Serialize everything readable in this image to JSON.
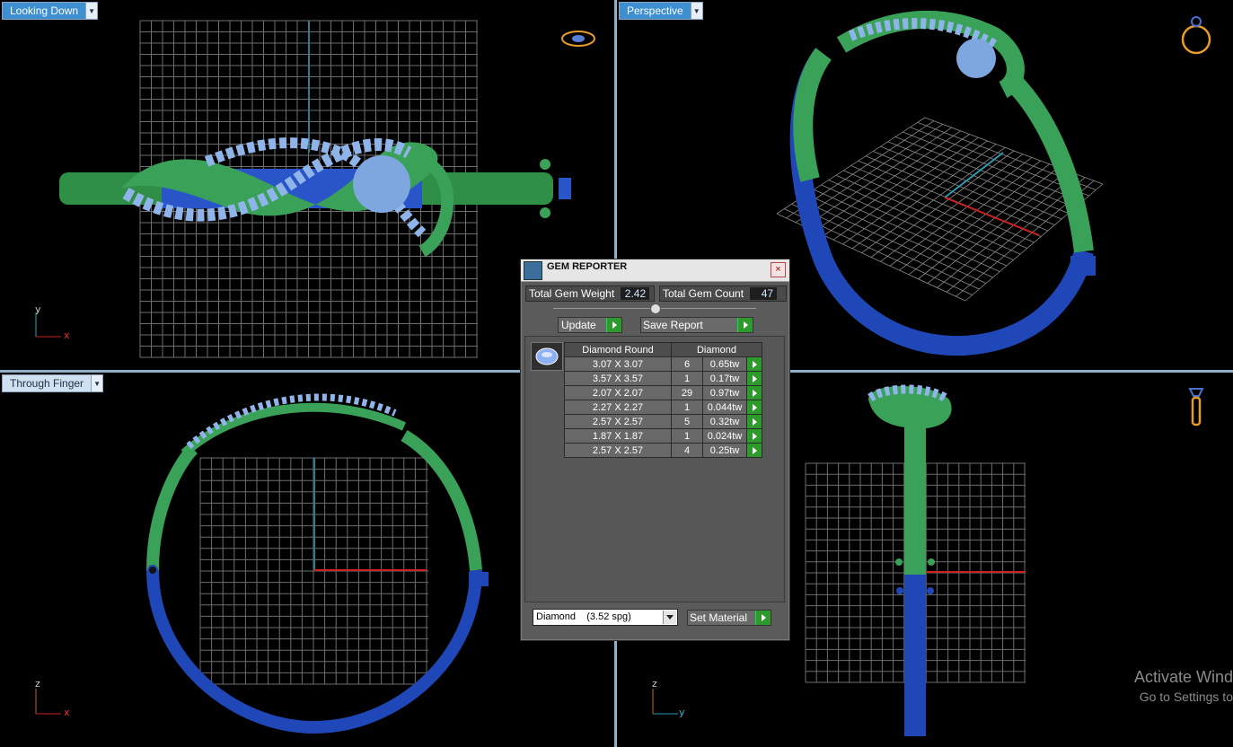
{
  "viewports": {
    "top_left": {
      "label": "Looking Down",
      "axes": [
        "y",
        "x"
      ]
    },
    "top_right": {
      "label": "Perspective"
    },
    "bottom_left": {
      "label": "Through Finger",
      "axes": [
        "z",
        "x"
      ]
    },
    "bottom_right": {
      "axes": [
        "z",
        "y"
      ]
    }
  },
  "gem_reporter": {
    "title": "GEM REPORTER",
    "close": "×",
    "total_weight_label": "Total Gem Weight",
    "total_weight_value": "2.42",
    "total_count_label": "Total Gem Count",
    "total_count_value": "47",
    "update_label": "Update",
    "save_report_label": "Save Report",
    "table": {
      "headers": [
        "Diamond Round",
        "Diamond"
      ],
      "rows": [
        {
          "size": "3.07 X 3.07",
          "count": "6",
          "weight": "0.65tw"
        },
        {
          "size": "3.57 X 3.57",
          "count": "1",
          "weight": "0.17tw"
        },
        {
          "size": "2.07 X 2.07",
          "count": "29",
          "weight": "0.97tw"
        },
        {
          "size": "2.27 X 2.27",
          "count": "1",
          "weight": "0.044tw"
        },
        {
          "size": "2.57 X 2.57",
          "count": "5",
          "weight": "0.32tw"
        },
        {
          "size": "1.87 X 1.87",
          "count": "1",
          "weight": "0.024tw"
        },
        {
          "size": "2.57 X 2.57",
          "count": "4",
          "weight": "0.25tw"
        }
      ]
    },
    "material_value": "Diamond    (3.52 spg)",
    "set_material_label": "Set Material"
  },
  "watermark": {
    "line1": "Activate Wind",
    "line2": "Go to Settings to"
  },
  "colors": {
    "metal_green": "#3fa35a",
    "metal_blue": "#1f47b8",
    "gem_blue": "#8fb4ea",
    "grid": "#7a7a7a",
    "accent_tab": "#3d8fd0"
  }
}
